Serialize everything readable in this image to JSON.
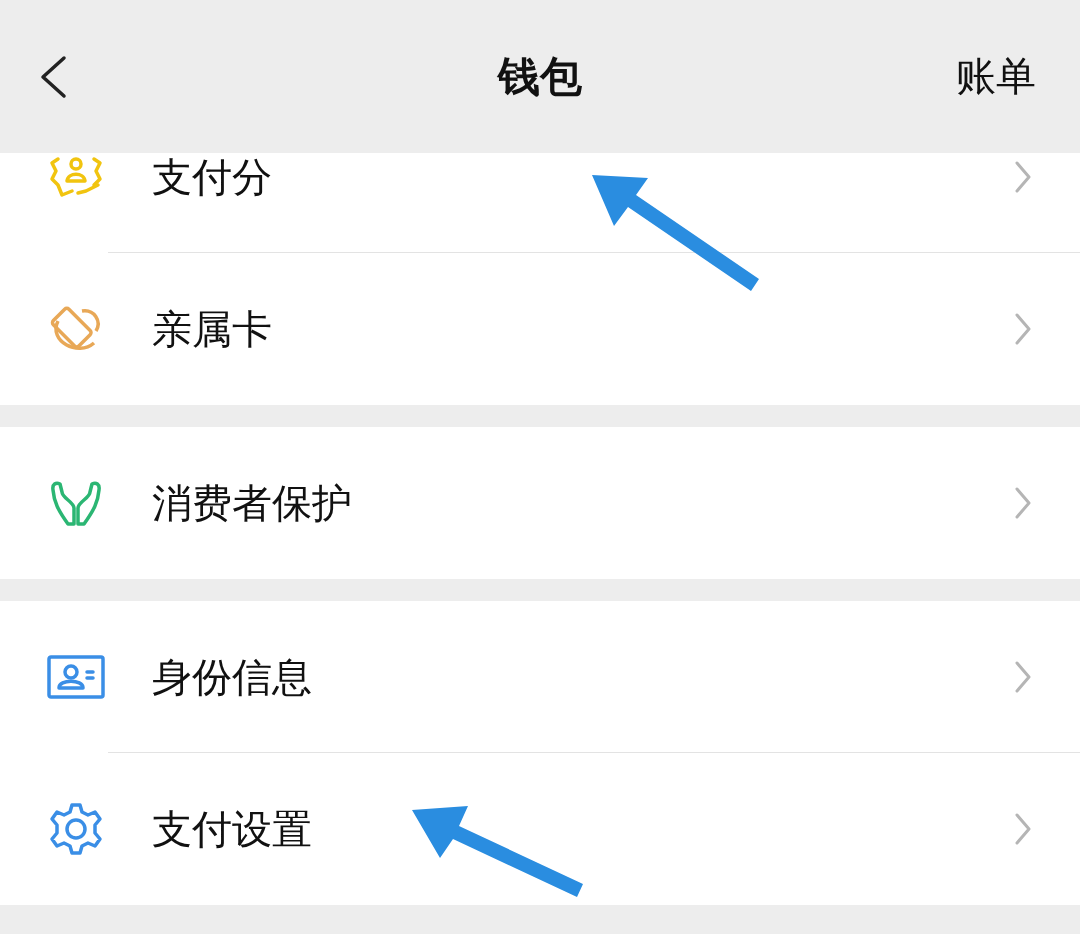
{
  "header": {
    "title": "钱包",
    "action": "账单"
  },
  "groups": [
    {
      "items": [
        {
          "kind": "score",
          "label": "支付分"
        },
        {
          "kind": "family-card",
          "label": "亲属卡"
        }
      ]
    },
    {
      "items": [
        {
          "kind": "protection",
          "label": "消费者保护"
        }
      ]
    },
    {
      "items": [
        {
          "kind": "identity",
          "label": "身份信息"
        },
        {
          "kind": "settings",
          "label": "支付设置"
        }
      ]
    }
  ]
}
